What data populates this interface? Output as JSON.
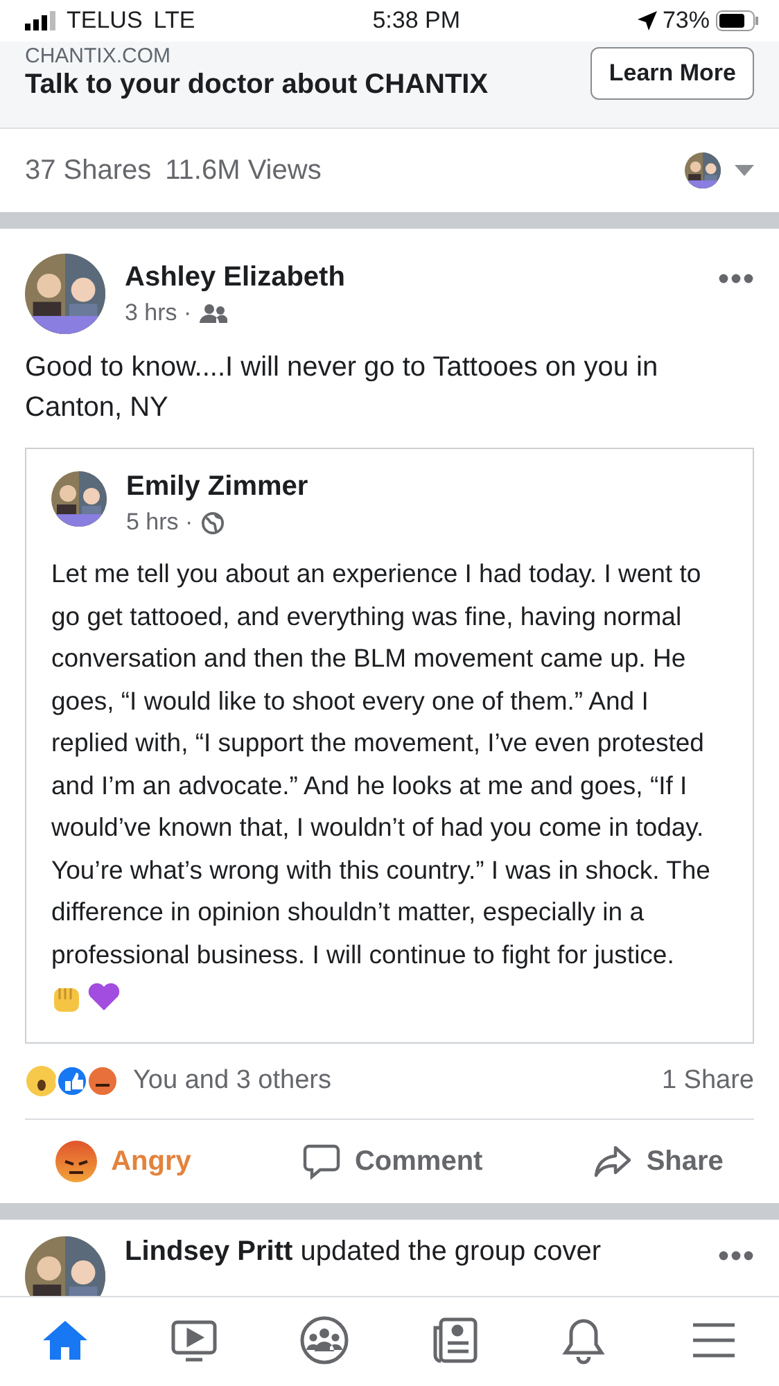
{
  "status_bar": {
    "carrier": "TELUS",
    "network": "LTE",
    "time": "5:38 PM",
    "battery": "73%"
  },
  "ad": {
    "domain": "CHANTIX.COM",
    "headline": "Talk to your doctor about CHANTIX",
    "button": "Learn More"
  },
  "ad_stats": {
    "shares": "37 Shares",
    "views": "11.6M Views"
  },
  "post": {
    "author": "Ashley Elizabeth",
    "time": "3 hrs ·",
    "text": "Good to know....I will never go to Tattooes on you in Canton, NY",
    "shared": {
      "author": "Emily Zimmer",
      "time": "5 hrs ·",
      "text": "Let me tell you about an experience I had today. I went to go get tattooed, and everything was fine, having normal conversation and then the BLM movement came up. He goes, “I would like to shoot every one of them.” And I replied with, “I support the movement, I’ve even protested and I’m an advocate.” And he looks at me and goes, “If I would’ve known that, I wouldn’t of had you come in today. You’re what’s wrong with this country.” I was in shock. The difference in opinion shouldn’t matter, especially in a professional business. I will continue to fight for justice."
    },
    "reactions": "You and 3 others",
    "share_count": "1 Share",
    "actions": [
      {
        "kind": "angry",
        "label": "Angry",
        "selected": true
      },
      {
        "kind": "comment",
        "label": "Comment",
        "selected": false
      },
      {
        "kind": "share",
        "label": "Share",
        "selected": false
      }
    ]
  },
  "next_post": {
    "author": "Lindsey Pritt",
    "text": "updated the group cover"
  },
  "tab_bar": [
    {
      "kind": "home",
      "selected": true
    },
    {
      "kind": "watch",
      "selected": false
    },
    {
      "kind": "groups",
      "selected": false
    },
    {
      "kind": "news",
      "selected": false
    },
    {
      "kind": "bell",
      "selected": false
    },
    {
      "kind": "menu",
      "selected": false
    }
  ]
}
